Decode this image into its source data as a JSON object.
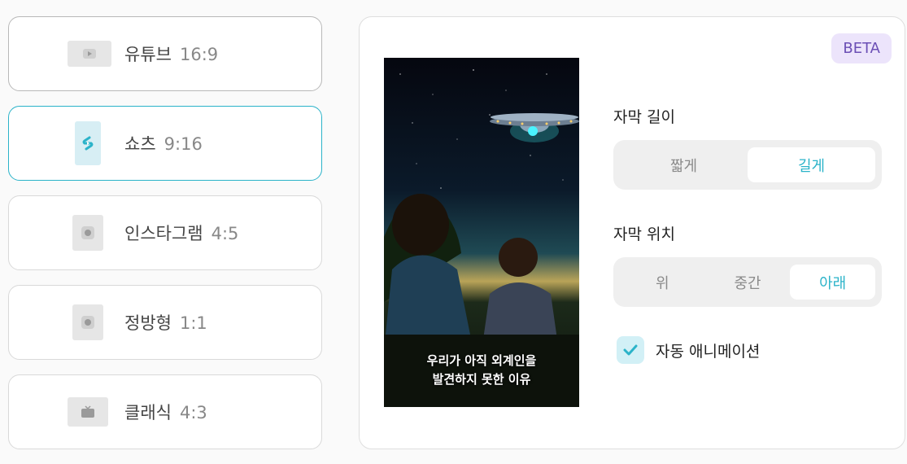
{
  "formats": [
    {
      "name": "유튜브",
      "ratio": "16:9",
      "icon": "youtube-icon"
    },
    {
      "name": "쇼츠",
      "ratio": "9:16",
      "icon": "shorts-icon"
    },
    {
      "name": "인스타그램",
      "ratio": "4:5",
      "icon": "instagram-icon"
    },
    {
      "name": "정방형",
      "ratio": "1:1",
      "icon": "square-icon"
    },
    {
      "name": "클래식",
      "ratio": "4:3",
      "icon": "tv-icon"
    }
  ],
  "selected_format": "쇼츠",
  "panel": {
    "badge": "BETA",
    "preview_caption_line1": "우리가 아직 외계인을",
    "preview_caption_line2": "발견하지 못한 이유",
    "subtitle_length": {
      "label": "자막 길이",
      "options": [
        "짧게",
        "길게"
      ],
      "selected": "길게"
    },
    "subtitle_position": {
      "label": "자막 위치",
      "options": [
        "위",
        "중간",
        "아래"
      ],
      "selected": "아래"
    },
    "auto_animation": {
      "label": "자동 애니메이션",
      "checked": true
    }
  },
  "colors": {
    "accent": "#2bb3c9",
    "beta_bg": "#ece4fb",
    "beta_text": "#6b4fb5"
  }
}
